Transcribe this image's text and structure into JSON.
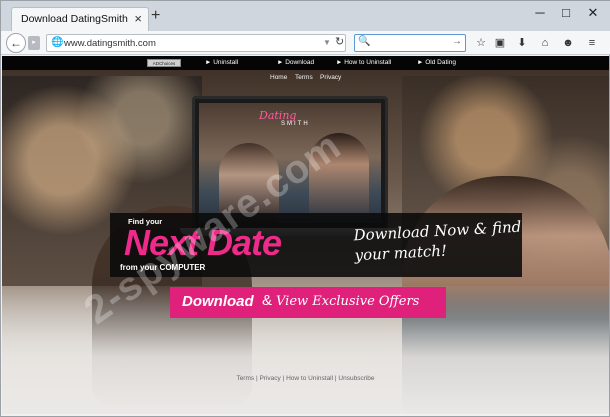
{
  "browser": {
    "tab_title": "Download DatingSmith",
    "tab_close": "×",
    "new_tab": "+",
    "win_minimize": "─",
    "win_maximize": "□",
    "win_close": "✕",
    "url": "www.datingsmith.com",
    "url_dropdown": "▼",
    "reload": "↻",
    "search_placeholder": "",
    "search_go": "→",
    "back": "←",
    "forward": "▸",
    "icons": {
      "globe": "🌐",
      "search": "🔍",
      "star": "☆",
      "clipboard": "▣",
      "download": "⬇",
      "home": "⌂",
      "chat": "☻",
      "menu": "≡"
    }
  },
  "page": {
    "brand_badge": "ADChoices",
    "top_links": [
      "► Uninstall",
      "► Download",
      "► How to Uninstall",
      "► Old Dating"
    ],
    "sub_nav": [
      "Home",
      "Terms",
      "Privacy"
    ],
    "laptop_logo_a": "Dating",
    "laptop_logo_b": "SMITH",
    "banner": {
      "find_your": "Find your",
      "headline": "Next Date",
      "from_computer": "from your COMPUTER",
      "tagline": "Download Now & find your match!"
    },
    "cta": {
      "download": "Download",
      "amp": "&",
      "offers": "View Exclusive Offers"
    },
    "footer": [
      "Terms",
      "Privacy",
      "How to Uninstall",
      "Unsubscribe"
    ],
    "footer_sep": "|",
    "watermark": "2-spyware.com"
  },
  "colors": {
    "accent_pink": "#ee2a8a",
    "cta_pink": "#e0217c",
    "top_strip": "#050505"
  }
}
